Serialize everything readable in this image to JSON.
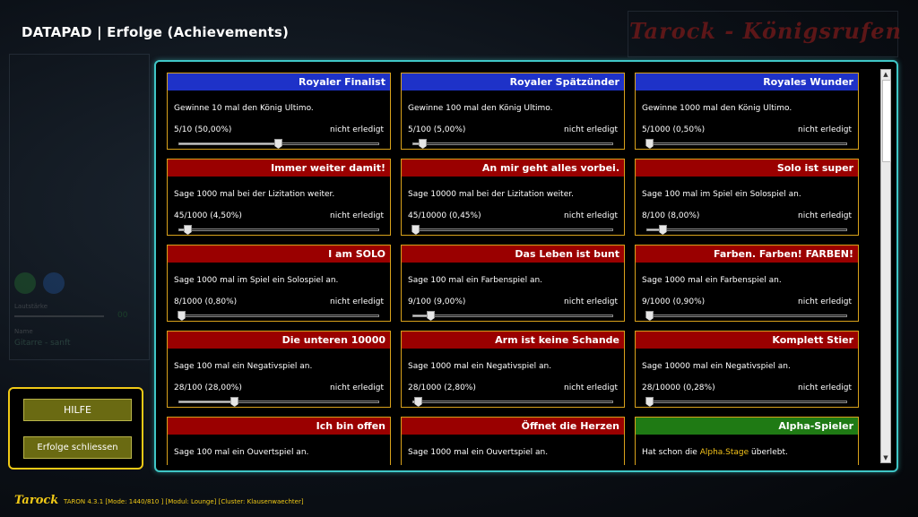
{
  "header": {
    "title": "DATAPAD | Erfolge (Achievements)",
    "brand": "Tarock - Königsrufen"
  },
  "colors": {
    "blue": "#1e32c8",
    "red": "#9a0000",
    "green": "#1f7a14",
    "border": "#d9a21b",
    "accent_teal": "#3fc6c6",
    "accent_yellow": "#f0c916"
  },
  "achievements": [
    {
      "title": "Royaler Finalist",
      "color": "blue",
      "desc": "Gewinne 10 mal den König Ultimo.",
      "progress": "5/10 (50,00%)",
      "status": "nicht erledigt",
      "fraction": 0.5
    },
    {
      "title": "Royaler Spätzünder",
      "color": "blue",
      "desc": "Gewinne 100 mal den König Ultimo.",
      "progress": "5/100 (5,00%)",
      "status": "nicht erledigt",
      "fraction": 0.05
    },
    {
      "title": "Royales Wunder",
      "color": "blue",
      "desc": "Gewinne 1000 mal den König Ultimo.",
      "progress": "5/1000 (0,50%)",
      "status": "nicht erledigt",
      "fraction": 0.005
    },
    {
      "title": "Immer weiter damit!",
      "color": "red",
      "desc": "Sage 1000 mal bei der Lizitation weiter.",
      "progress": "45/1000 (4,50%)",
      "status": "nicht erledigt",
      "fraction": 0.045
    },
    {
      "title": "An mir geht alles vorbei.",
      "color": "red",
      "desc": "Sage 10000 mal bei der Lizitation weiter.",
      "progress": "45/10000 (0,45%)",
      "status": "nicht erledigt",
      "fraction": 0.0045
    },
    {
      "title": "Solo ist super",
      "color": "red",
      "desc": "Sage 100 mal im Spiel ein Solospiel an.",
      "progress": "8/100 (8,00%)",
      "status": "nicht erledigt",
      "fraction": 0.08
    },
    {
      "title": "I am SOLO",
      "color": "red",
      "desc": "Sage 1000 mal im Spiel ein Solospiel an.",
      "progress": "8/1000 (0,80%)",
      "status": "nicht erledigt",
      "fraction": 0.008
    },
    {
      "title": "Das Leben ist bunt",
      "color": "red",
      "desc": "Sage 100 mal ein Farbenspiel an.",
      "progress": "9/100 (9,00%)",
      "status": "nicht erledigt",
      "fraction": 0.09
    },
    {
      "title": "Farben. Farben! FARBEN!",
      "color": "red",
      "desc": "Sage 1000 mal ein Farbenspiel an.",
      "progress": "9/1000 (0,90%)",
      "status": "nicht erledigt",
      "fraction": 0.009
    },
    {
      "title": "Die unteren 10000",
      "color": "red",
      "desc": "Sage 100 mal ein Negativspiel an.",
      "progress": "28/100 (28,00%)",
      "status": "nicht erledigt",
      "fraction": 0.28
    },
    {
      "title": "Arm ist keine Schande",
      "color": "red",
      "desc": "Sage 1000 mal ein Negativspiel an.",
      "progress": "28/1000 (2,80%)",
      "status": "nicht erledigt",
      "fraction": 0.028
    },
    {
      "title": "Komplett Stier",
      "color": "red",
      "desc": "Sage 10000 mal ein Negativspiel an.",
      "progress": "28/10000 (0,28%)",
      "status": "nicht erledigt",
      "fraction": 0.0028
    },
    {
      "title": "Ich bin offen",
      "color": "red",
      "desc": "Sage 100 mal ein Ouvertspiel an.",
      "progress": "",
      "status": "",
      "fraction": null
    },
    {
      "title": "Öffnet die Herzen",
      "color": "red",
      "desc": "Sage 1000 mal ein Ouvertspiel an.",
      "progress": "",
      "status": "",
      "fraction": null
    },
    {
      "title": "Alpha-Spieler",
      "color": "green",
      "desc_parts": [
        "Hat schon die ",
        "Alpha.Stage",
        " überlebt."
      ],
      "progress": "",
      "status": "",
      "fraction": null
    }
  ],
  "scroll": {
    "up_icon": "arrow-up-icon",
    "down_icon": "arrow-down-icon",
    "position": 0.0
  },
  "buttons": {
    "help_label": "HILFE",
    "close_label": "Erfolge schliessen"
  },
  "left_bg": {
    "volume_label": "Lautstärke",
    "volume_value": "00",
    "name_label": "Name",
    "name_value": "Gitarre - sanft"
  },
  "footer": {
    "logo": "Tarock",
    "info": "TARON 4.3.1 [Mode: 1440/810 ] [Modul: Lounge] [Cluster: Klausenwaechter]"
  }
}
